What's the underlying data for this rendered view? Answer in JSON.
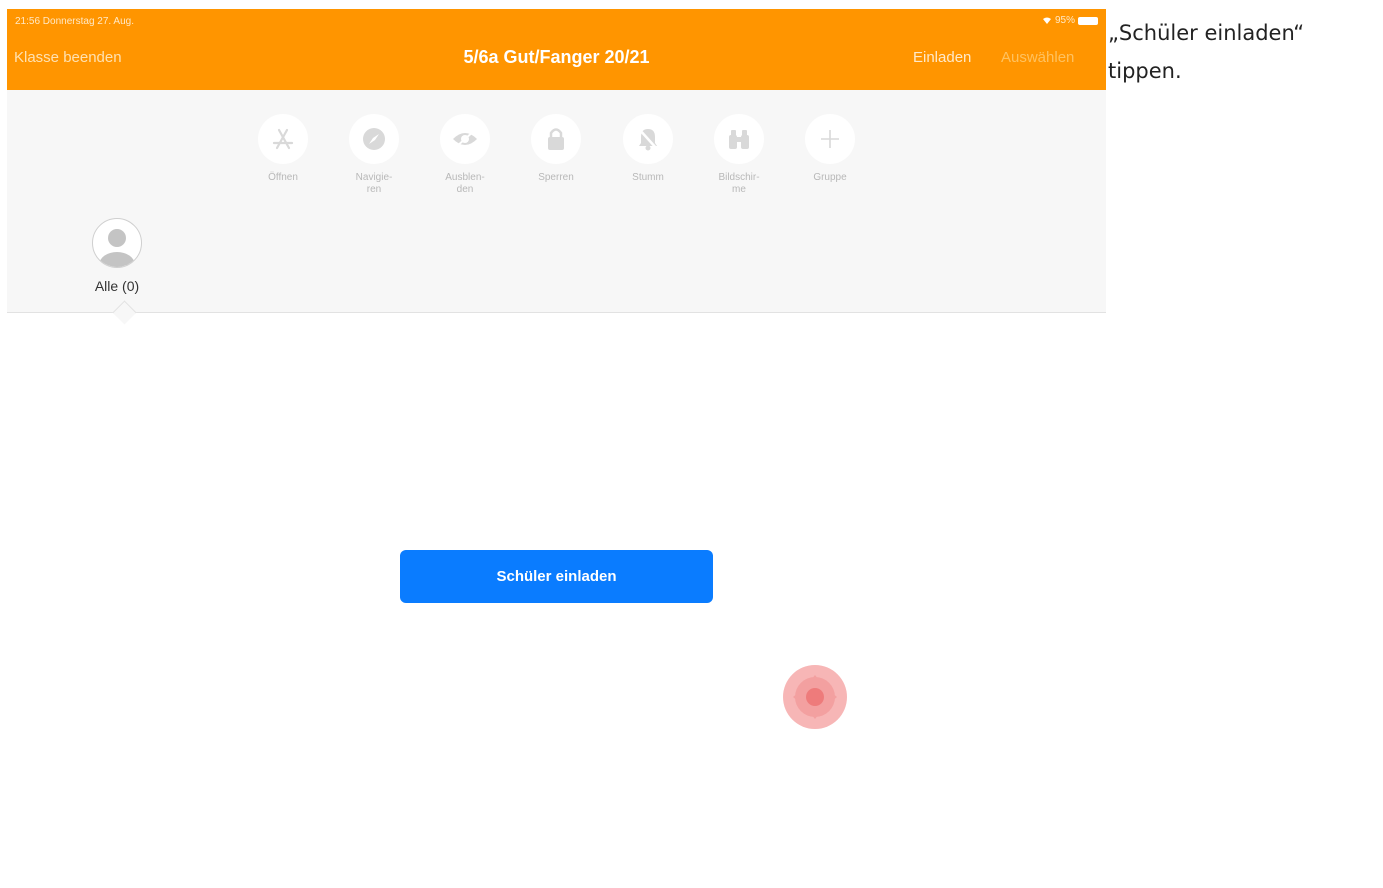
{
  "status_bar": {
    "time": "21:56  Donnerstag 27. Aug.",
    "battery": "95%"
  },
  "nav": {
    "left": "Klasse beenden",
    "title": "5/6a Gut/Fanger 20/21",
    "invite": "Einladen",
    "select": "Auswählen",
    "color": "#ff9500"
  },
  "tools": [
    {
      "icon": "app-store-icon",
      "label": "Öffnen"
    },
    {
      "icon": "compass-icon",
      "label": "Navigie-\nren"
    },
    {
      "icon": "eye-icon",
      "label": "Ausblen-\nden"
    },
    {
      "icon": "lock-icon",
      "label": "Sperren"
    },
    {
      "icon": "bell-slash-icon",
      "label": "Stumm"
    },
    {
      "icon": "binoculars-icon",
      "label": "Bildschir-\nme"
    },
    {
      "icon": "plus-icon",
      "label": "Gruppe"
    }
  ],
  "group": {
    "label": "Alle (0)"
  },
  "main": {
    "invite_button": "Schüler einladen",
    "button_color": "#0a7cff"
  },
  "instruction": {
    "line1": "„Schüler einladen“",
    "line2": "tippen."
  }
}
